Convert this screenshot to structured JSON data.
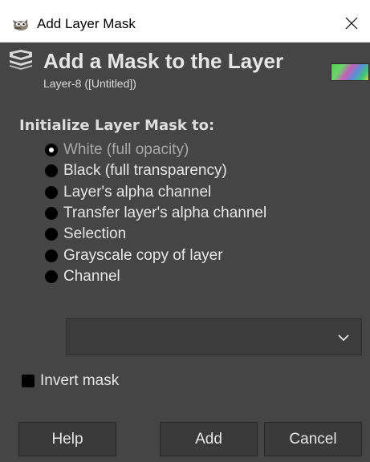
{
  "window": {
    "title": "Add Layer Mask",
    "close_label": "Close"
  },
  "header": {
    "title": "Add a Mask to the Layer",
    "subtitle": "Layer-8 ([Untitled])"
  },
  "mask_init": {
    "label": "Initialize Layer Mask to:",
    "options": [
      {
        "label": "White (full opacity)",
        "selected": true
      },
      {
        "label": "Black (full transparency)",
        "selected": false
      },
      {
        "label": "Layer's alpha channel",
        "selected": false
      },
      {
        "label": "Transfer layer's alpha channel",
        "selected": false
      },
      {
        "label": "Selection",
        "selected": false
      },
      {
        "label": "Grayscale copy of layer",
        "selected": false
      },
      {
        "label": "Channel",
        "selected": false
      }
    ],
    "channel_value": ""
  },
  "invert": {
    "label": "Invert mask",
    "checked": false
  },
  "buttons": {
    "help": "Help",
    "add": "Add",
    "cancel": "Cancel"
  },
  "colors": {
    "background": "#454545",
    "text": "#e6e6e6",
    "disabled_text": "#a8a8a8",
    "titlebar": "#ffffff"
  },
  "icons": {
    "app": "gimp-wilber-icon",
    "header": "layer-mask-icon",
    "close": "close-icon",
    "dropdown": "chevron-down-icon"
  }
}
